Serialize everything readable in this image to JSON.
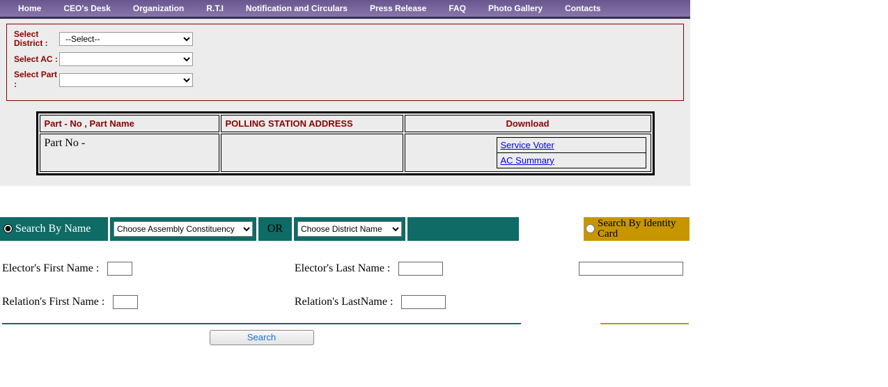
{
  "nav": [
    "Home",
    "CEO's Desk",
    "Organization",
    "R.T.I",
    "Notification and Circulars",
    "Press Release",
    "FAQ",
    "Photo Gallery",
    "Contacts"
  ],
  "filter": {
    "l1": "Select District :",
    "l2": "Select AC :",
    "l3": "Select Part :",
    "opt1": "--Select--"
  },
  "table": {
    "h1": "Part - No , Part Name",
    "h2": "POLLING STATION ADDRESS",
    "h3": "Download",
    "part": "Part No -",
    "link1": "Service Voter",
    "link2": "AC Summary"
  },
  "search": {
    "byName": "Search By Name",
    "ac": "Choose Assembly Constituency",
    "or": "OR",
    "dist": "Choose District Name",
    "byId": " Search By Identity Card",
    "efn": "Elector's First Name :",
    "eln": "Elector's Last Name :",
    "rfn": "Relation's First Name :",
    "rln": "Relation's LastName :",
    "btn": "Search"
  }
}
